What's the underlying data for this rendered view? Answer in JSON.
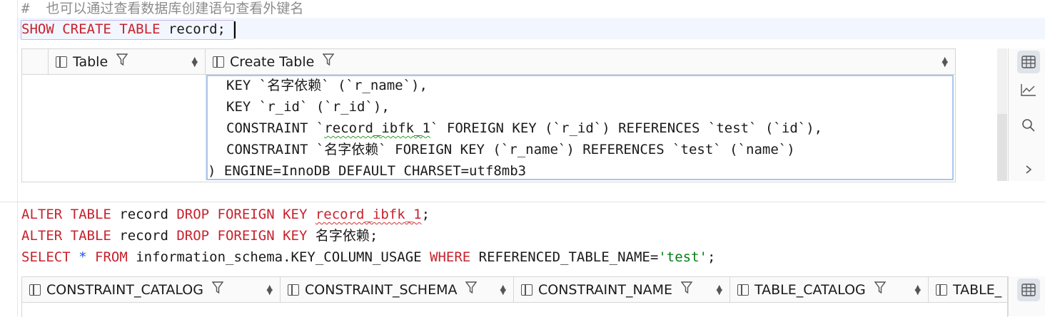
{
  "editor": {
    "comment": "#  也可以通过查看数据库创建语句查看外键名",
    "line1": {
      "kw": "SHOW CREATE TABLE",
      "ident": " record",
      "end": ";"
    },
    "alter1": {
      "kw1": "ALTER TABLE",
      "t": " record ",
      "kw2": "DROP FOREIGN KEY",
      "sp": " ",
      "name": "record_ibfk_1",
      "end": ";"
    },
    "alter2": {
      "kw1": "ALTER TABLE",
      "t": " record ",
      "kw2": "DROP FOREIGN KEY",
      "sp": " ",
      "name": "名字依赖",
      "end": ";"
    },
    "select": {
      "kw1": "SELECT",
      "sp1": " ",
      "star": "*",
      "sp2": " ",
      "kw2": "FROM",
      "t": " information_schema.KEY_COLUMN_USAGE ",
      "kw3": "WHERE",
      "cond": " REFERENCED_TABLE_NAME=",
      "str": "'test'",
      "end": ";"
    }
  },
  "result1": {
    "headers": [
      "Table",
      "Create Table"
    ],
    "value_lines": [
      "KEY `名字依赖` (`r_name`),",
      "KEY `r_id` (`r_id`),",
      "CONSTRAINT `record_ibfk_1` FOREIGN KEY (`r_id`) REFERENCES `test` (`id`),",
      "CONSTRAINT `名字依赖` FOREIGN KEY (`r_name`) REFERENCES `test` (`name`)",
      ") ENGINE=InnoDB DEFAULT CHARSET=utf8mb3"
    ],
    "value_line3_parts": {
      "pre": "CONSTRAINT `",
      "mark": "record_ibfk_1",
      "post": "` FOREIGN KEY (`r_id`) REFERENCES `test` (`id`),"
    }
  },
  "result2": {
    "headers": [
      "CONSTRAINT_CATALOG",
      "CONSTRAINT_SCHEMA",
      "CONSTRAINT_NAME",
      "TABLE_CATALOG",
      "TABLE_"
    ]
  },
  "icons": {
    "filter": "funnel-icon",
    "sort": "sort-arrows-icon",
    "side": [
      "table-view-icon",
      "chart-icon",
      "search-icon",
      "chevron-right-icon"
    ]
  }
}
